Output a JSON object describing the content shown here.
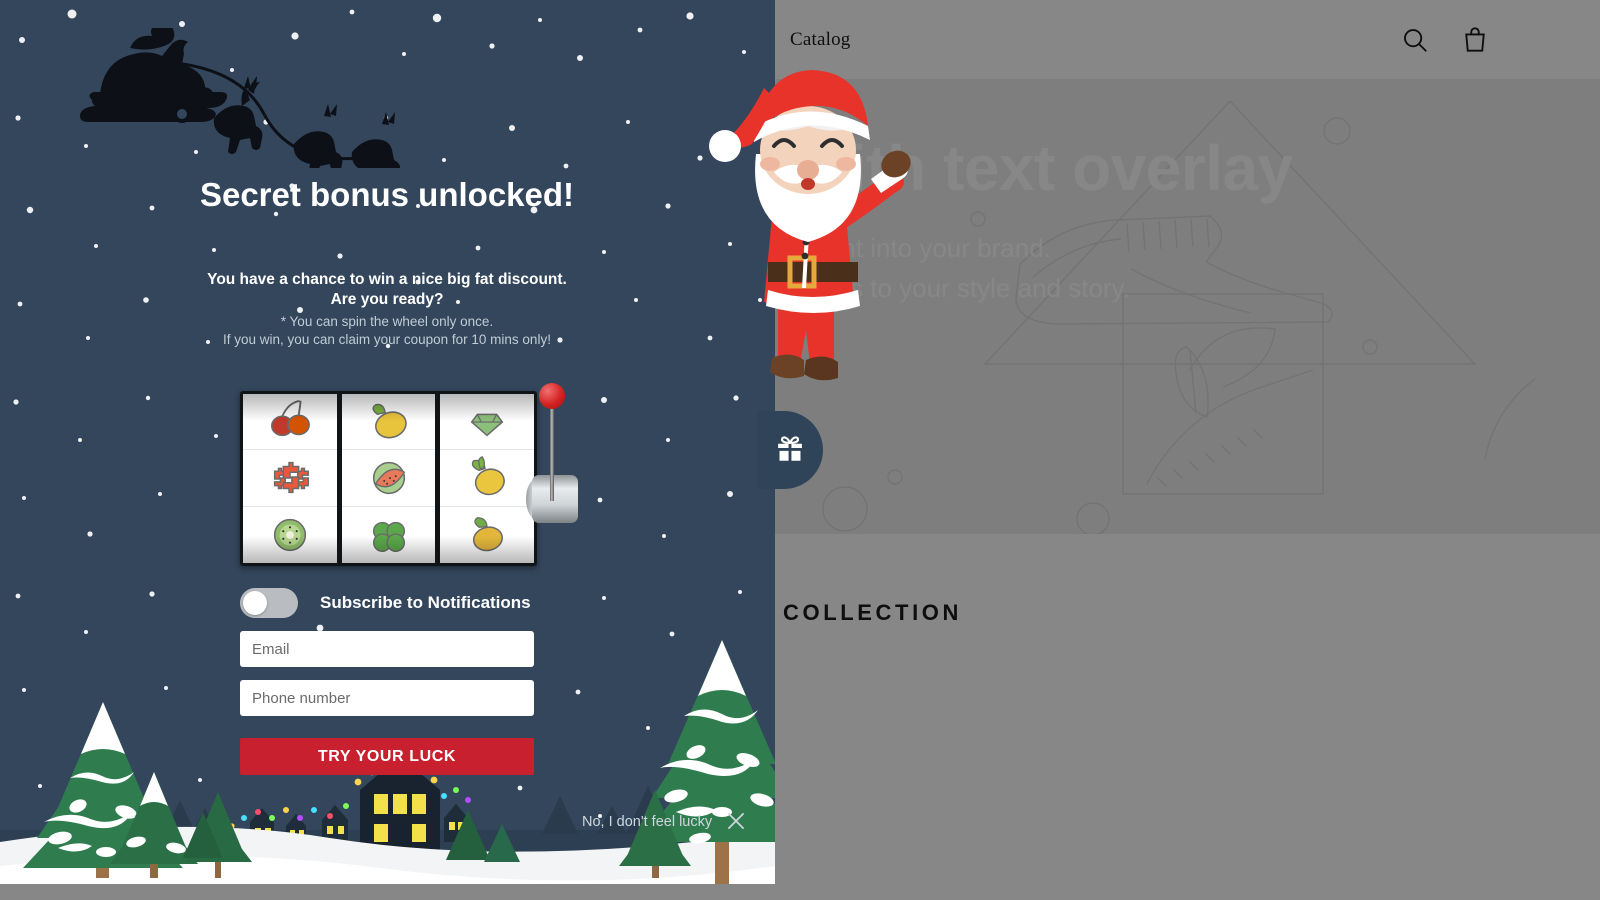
{
  "store": {
    "nav_link": "Catalog",
    "icons": {
      "search": "search-icon",
      "cart": "shopping-bag-icon"
    },
    "hero": {
      "title": "Image with text overlay",
      "subtitle_line1": "Give customers insight into your brand.",
      "subtitle_line2": "Describe how it relates to your style and story."
    },
    "collection_title": "COLLECTION"
  },
  "gift_tab": {
    "icon": "gift-icon"
  },
  "popup": {
    "title": "Secret bonus unlocked!",
    "subtitle": "You have a chance to win a nice big fat discount. Are you ready?",
    "fineprint_line1": "* You can spin the wheel only once.",
    "fineprint_line2": "If you win, you can claim your coupon for 10 mins only!",
    "toggle": {
      "label": "Subscribe to Notifications",
      "state": "off"
    },
    "email": {
      "placeholder": "Email",
      "value": ""
    },
    "phone": {
      "placeholder": "Phone number",
      "value": ""
    },
    "cta_label": "TRY YOUR LUCK",
    "decline_label": "No, I don't feel lucky",
    "close_icon": "close-icon",
    "slot": {
      "lever": "slot-lever",
      "reels": [
        {
          "top": "cherries",
          "middle": "dollars",
          "bottom": "kiwi"
        },
        {
          "top": "lemon",
          "middle": "watermelon",
          "bottom": "clover"
        },
        {
          "top": "emerald",
          "middle": "lemon",
          "bottom": "mango"
        }
      ]
    },
    "decor": {
      "sleigh": "santa-sleigh-silhouette",
      "santa": "santa-claus-character",
      "trees": "snowy-pine-trees",
      "village": "lit-village-houses"
    }
  },
  "colors": {
    "popup_bg": "#33465c",
    "cta_red": "#c8202f",
    "gift_tab": "#2f4459",
    "snow": "#ffffff",
    "tree_green": "#2f7d4f"
  }
}
